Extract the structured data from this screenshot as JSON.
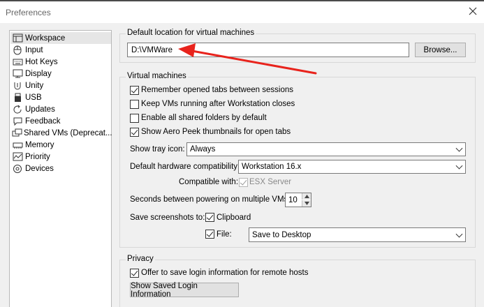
{
  "window": {
    "title": "Preferences"
  },
  "sidebar": {
    "items": [
      {
        "label": "Workspace",
        "icon": "workspace-icon"
      },
      {
        "label": "Input",
        "icon": "mouse-icon"
      },
      {
        "label": "Hot Keys",
        "icon": "keyboard-icon"
      },
      {
        "label": "Display",
        "icon": "monitor-icon"
      },
      {
        "label": "Unity",
        "icon": "unity-icon"
      },
      {
        "label": "USB",
        "icon": "usb-icon"
      },
      {
        "label": "Updates",
        "icon": "refresh-icon"
      },
      {
        "label": "Feedback",
        "icon": "feedback-icon"
      },
      {
        "label": "Shared VMs (Deprecat...",
        "icon": "shared-vms-icon"
      },
      {
        "label": "Memory",
        "icon": "memory-icon"
      },
      {
        "label": "Priority",
        "icon": "priority-icon"
      },
      {
        "label": "Devices",
        "icon": "devices-icon"
      }
    ],
    "selected": "Workspace"
  },
  "default_location": {
    "group_label": "Default location for virtual machines",
    "path_value": "D:\\VMWare",
    "browse_label": "Browse..."
  },
  "virtual_machines": {
    "group_label": "Virtual machines",
    "checkboxes": [
      {
        "label": "Remember opened tabs between sessions",
        "checked": true
      },
      {
        "label": "Keep VMs running after Workstation closes",
        "checked": false
      },
      {
        "label": "Enable all shared folders by default",
        "checked": false
      },
      {
        "label": "Show Aero Peek thumbnails for open tabs",
        "checked": true
      }
    ],
    "tray_icon_label": "Show tray icon:",
    "tray_icon_value": "Always",
    "hw_compat_label": "Default hardware compatibility:",
    "hw_compat_value": "Workstation 16.x",
    "compatible_with_label": "Compatible with:",
    "compatible_with_option": "ESX Server",
    "compatible_with_checked": true,
    "seconds_label": "Seconds between powering on multiple VMs:",
    "seconds_value": "10",
    "screenshots_label": "Save screenshots to:",
    "clipboard_label": "Clipboard",
    "clipboard_checked": true,
    "file_label": "File:",
    "file_checked": true,
    "file_value": "Save to Desktop"
  },
  "privacy": {
    "group_label": "Privacy",
    "offer_label": "Offer to save login information for remote hosts",
    "offer_checked": true,
    "show_saved_label": "Show Saved Login Information"
  },
  "annotation": {
    "arrow_color": "#e8231c"
  },
  "colors": {
    "sidebar_selected": "#e6e6e6",
    "panel_bg": "#f0f0f0"
  }
}
